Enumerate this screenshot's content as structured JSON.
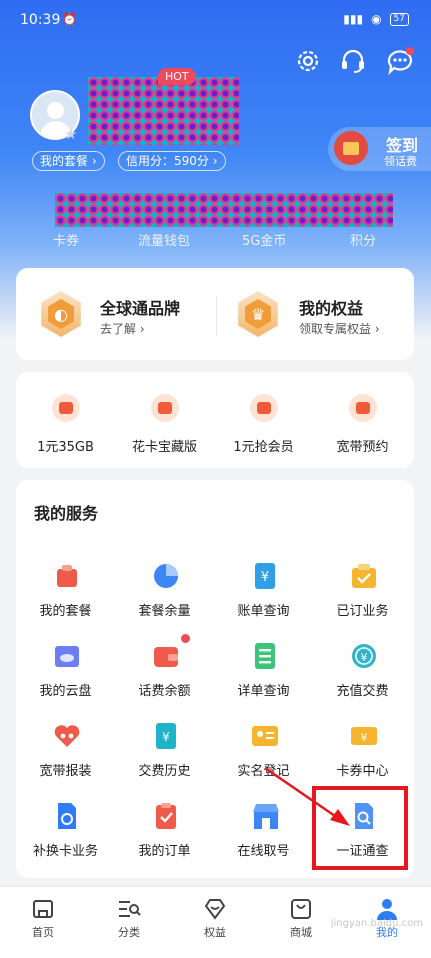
{
  "status_bar": {
    "time": "10:39",
    "battery": "57"
  },
  "profile": {
    "plan_label": "我的套餐 ›",
    "credit_label": "信用分：590分 ›"
  },
  "checkin": {
    "title": "签到",
    "subtitle": "领话费"
  },
  "quick_labels": [
    "卡券",
    "流量钱包",
    "5G金币",
    "积分"
  ],
  "benefits": [
    {
      "title": "全球通品牌",
      "subtitle": "去了解 ›"
    },
    {
      "title": "我的权益",
      "subtitle": "领取专属权益 ›"
    }
  ],
  "promos": [
    {
      "label": "1元35GB",
      "icon": "wifi-bag-icon"
    },
    {
      "label": "花卡宝藏版",
      "icon": "flower-card-icon"
    },
    {
      "label": "1元抢会员",
      "icon": "member-bag-icon"
    },
    {
      "label": "宽带预约",
      "icon": "broadband-icon"
    }
  ],
  "services": {
    "title": "我的服务",
    "hot_badge": "HOT",
    "items": [
      {
        "label": "我的套餐",
        "icon": "package-icon"
      },
      {
        "label": "套餐余量",
        "icon": "pie-chart-icon"
      },
      {
        "label": "账单查询",
        "icon": "bill-icon"
      },
      {
        "label": "已订业务",
        "icon": "subscribed-icon"
      },
      {
        "label": "我的云盘",
        "icon": "cloud-drive-icon"
      },
      {
        "label": "话费余额",
        "icon": "wallet-icon"
      },
      {
        "label": "详单查询",
        "icon": "detail-list-icon"
      },
      {
        "label": "充值交费",
        "icon": "recharge-icon"
      },
      {
        "label": "宽带报装",
        "icon": "broadband-install-icon"
      },
      {
        "label": "交费历史",
        "icon": "payment-history-icon"
      },
      {
        "label": "实名登记",
        "icon": "id-card-icon"
      },
      {
        "label": "卡券中心",
        "icon": "coupon-icon"
      },
      {
        "label": "补换卡业务",
        "icon": "sim-card-icon"
      },
      {
        "label": "我的订单",
        "icon": "order-icon"
      },
      {
        "label": "在线取号",
        "icon": "store-icon"
      },
      {
        "label": "一证通查",
        "icon": "id-check-icon"
      }
    ]
  },
  "tabs": [
    {
      "label": "首页",
      "icon": "home-icon"
    },
    {
      "label": "分类",
      "icon": "category-icon"
    },
    {
      "label": "权益",
      "icon": "diamond-icon"
    },
    {
      "label": "商城",
      "icon": "bag-icon"
    },
    {
      "label": "我的",
      "icon": "user-icon",
      "active": true
    }
  ],
  "watermark": "jingyan.baidu.com",
  "colors": {
    "primary": "#2f7cf6",
    "highlight_box": "#e8161d",
    "accent": "#f09c3a"
  }
}
